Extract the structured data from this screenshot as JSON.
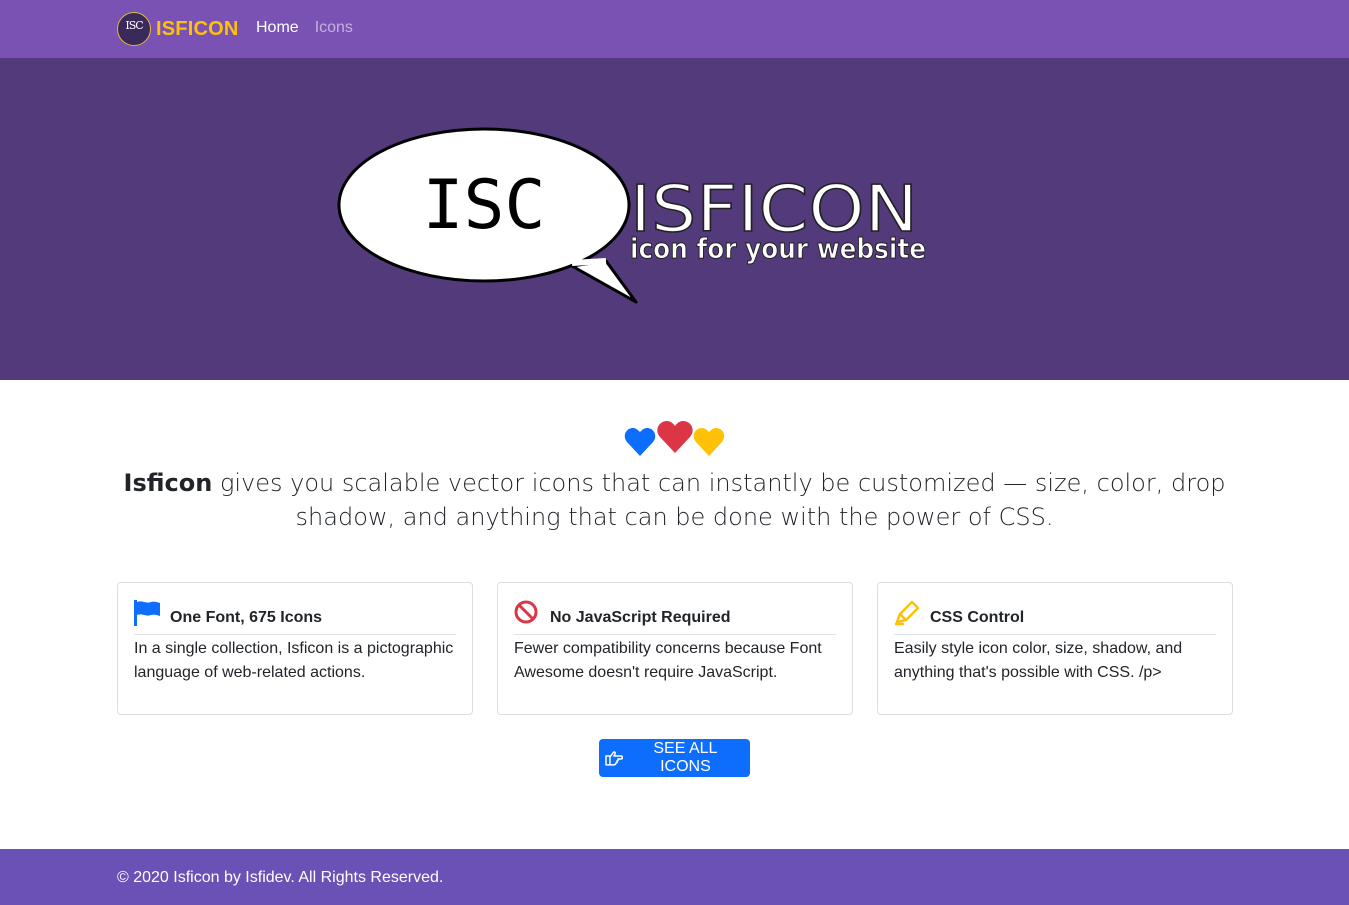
{
  "nav": {
    "logo_text": "ISC",
    "brand": "ISFICON",
    "links": [
      {
        "label": "Home",
        "active": true
      },
      {
        "label": "Icons",
        "active": false
      }
    ]
  },
  "hero": {
    "bubble_text": "ISC",
    "title": "ISFICON",
    "tagline": "icon for your website"
  },
  "intro": {
    "hearts": [
      {
        "color": "#0d6efd",
        "icon": "heart-icon"
      },
      {
        "color": "#dc3545",
        "icon": "heart-icon"
      },
      {
        "color": "#ffc107",
        "icon": "heart-icon"
      }
    ],
    "brand_bold": "Isficon",
    "text": " gives you scalable vector icons that can instantly be customized — size, color, drop shadow, and anything that can be done with the power of CSS."
  },
  "features": [
    {
      "icon": "flag-icon",
      "icon_color": "#0d6efd",
      "title": "One Font, 675 Icons",
      "text": "In a single collection, Isficon is a pictographic language of web-related actions."
    },
    {
      "icon": "ban-icon",
      "icon_color": "#dc3545",
      "title": "No JavaScript Required",
      "text": "Fewer compatibility concerns because Font Awesome doesn't require JavaScript."
    },
    {
      "icon": "pencil-icon",
      "icon_color": "#ffc107",
      "title": "CSS Control",
      "text": "Easily style icon color, size, shadow, and anything that's possible with CSS. /p>"
    }
  ],
  "cta": {
    "label": "SEE ALL ICONS",
    "icon": "hand-pointing-right-icon"
  },
  "footer": {
    "text": "© 2020 Isficon by Isfidev. All Rights Reserved."
  },
  "colors": {
    "navbar": "#7952b3",
    "hero": "#533a7b",
    "footer": "#6a51b5",
    "brand": "#ffc107",
    "primary": "#0d6efd"
  }
}
